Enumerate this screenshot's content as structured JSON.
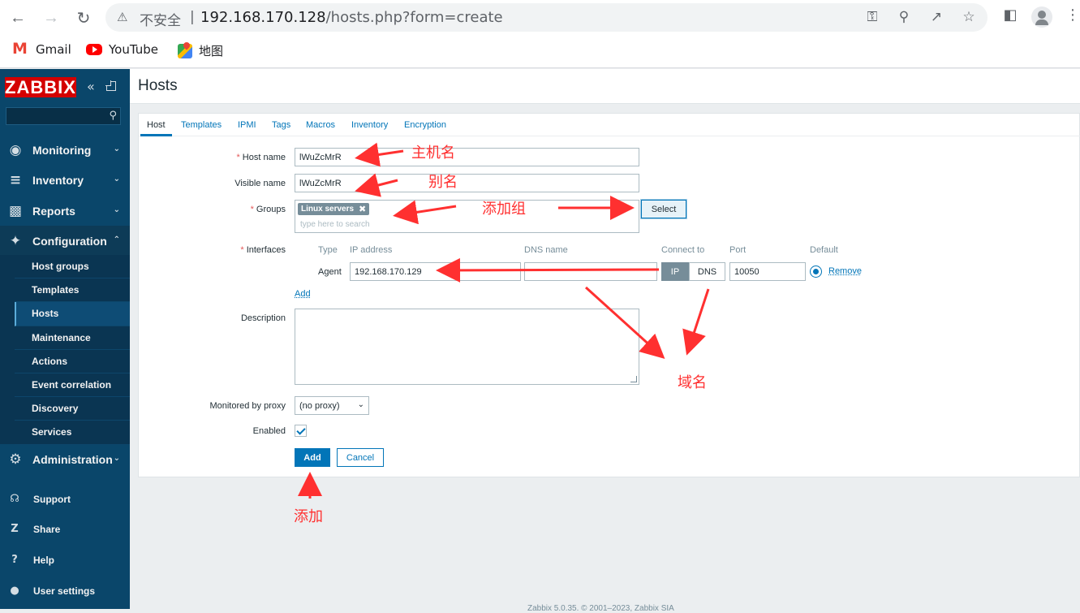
{
  "browser": {
    "insecure_label": "不安全",
    "separator": "|",
    "url_host": "192.168.170.128",
    "url_rest": "/hosts.php?form=create",
    "bookmarks": [
      {
        "label": "Gmail",
        "icon": "gmail-icon"
      },
      {
        "label": "YouTube",
        "icon": "youtube-icon"
      },
      {
        "label": "地图",
        "icon": "maps-icon"
      }
    ]
  },
  "sidebar": {
    "logo": "ZABBIX",
    "menu": [
      {
        "label": "Monitoring",
        "icon": "eye-icon"
      },
      {
        "label": "Inventory",
        "icon": "list-icon"
      },
      {
        "label": "Reports",
        "icon": "bar-chart-icon"
      },
      {
        "label": "Configuration",
        "icon": "wrench-icon"
      },
      {
        "label": "Administration",
        "icon": "gear-icon"
      }
    ],
    "config_submenu": [
      "Host groups",
      "Templates",
      "Hosts",
      "Maintenance",
      "Actions",
      "Event correlation",
      "Discovery",
      "Services"
    ],
    "active_submenu": "Hosts",
    "bottom": [
      {
        "label": "Support",
        "icon": "headset-icon"
      },
      {
        "label": "Share",
        "icon": "share-z-icon"
      },
      {
        "label": "Help",
        "icon": "question-icon"
      },
      {
        "label": "User settings",
        "icon": "user-icon"
      }
    ]
  },
  "page": {
    "title": "Hosts",
    "tabs": [
      "Host",
      "Templates",
      "IPMI",
      "Tags",
      "Macros",
      "Inventory",
      "Encryption"
    ],
    "active_tab": "Host"
  },
  "form": {
    "host_name_label": "Host name",
    "host_name_value": "lWuZcMrR",
    "visible_name_label": "Visible name",
    "visible_name_value": "lWuZcMrR",
    "groups_label": "Groups",
    "group_chip": "Linux servers",
    "groups_placeholder": "type here to search",
    "select_button": "Select",
    "interfaces_label": "Interfaces",
    "interface_headers": [
      "Type",
      "IP address",
      "DNS name",
      "Connect to",
      "Port",
      "Default"
    ],
    "interface_type": "Agent",
    "ip_value": "192.168.170.129",
    "dns_value": "",
    "connect_ip": "IP",
    "connect_dns": "DNS",
    "port_value": "10050",
    "remove_link": "Remove",
    "add_link": "Add",
    "description_label": "Description",
    "proxy_label": "Monitored by proxy",
    "proxy_value": "(no proxy)",
    "enabled_label": "Enabled",
    "add_button": "Add",
    "cancel_button": "Cancel"
  },
  "annotations": {
    "host_name": "主机名",
    "alias": "别名",
    "add_group": "添加组",
    "domain_name": "域名",
    "add": "添加"
  },
  "footer": "Zabbix 5.0.35. © 2001–2023, Zabbix SIA",
  "colors": {
    "sidebar": "#0a466a",
    "accent": "#0275b8",
    "logo": "#d40000",
    "annotation": "#ff3030"
  }
}
